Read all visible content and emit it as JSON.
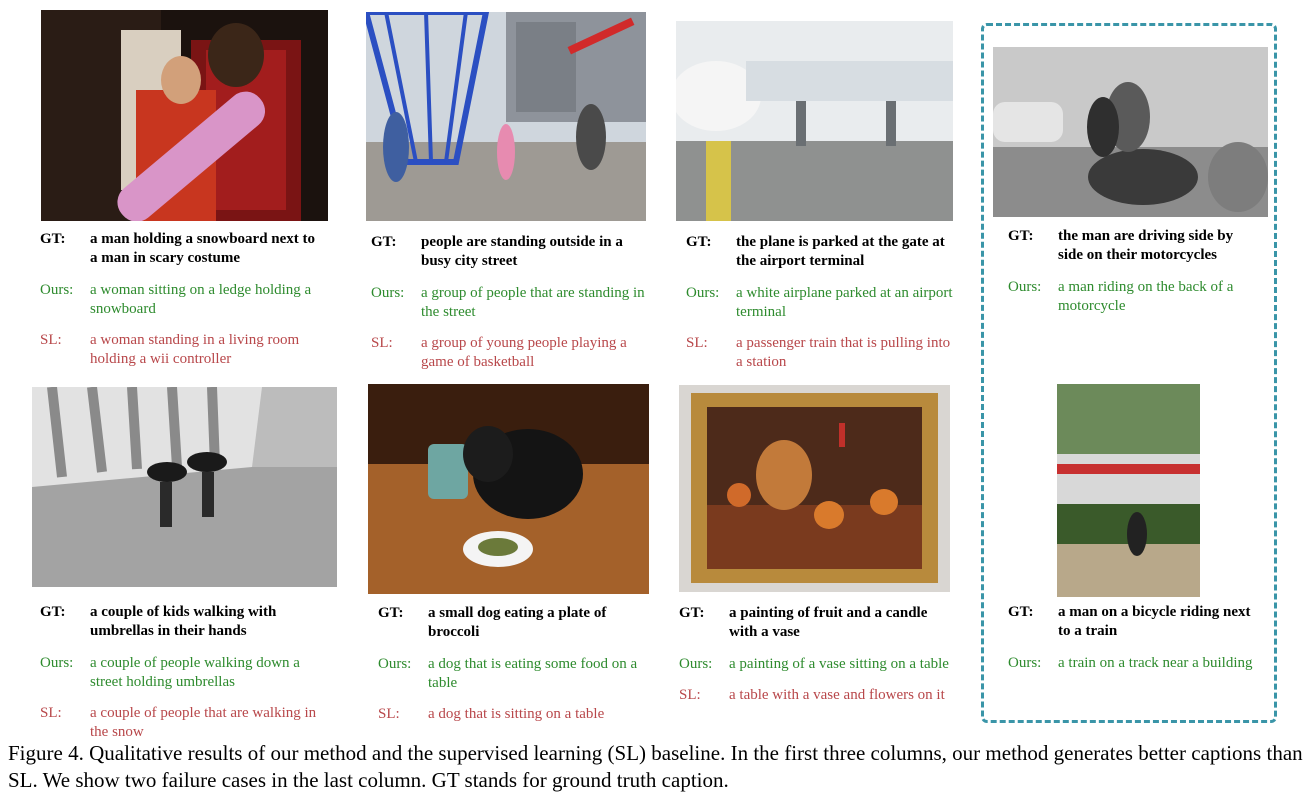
{
  "figure": {
    "caption": "Figure 4.  Qualitative results of our method and the supervised learning (SL) baseline. In the first three columns, our method generates better captions than SL. We show two failure cases in the last column. GT stands for ground truth caption."
  },
  "labels": {
    "gt": "GT:",
    "ours": "Ours:",
    "sl": "SL:"
  },
  "examples": [
    {
      "gt": "a man holding a snowboard next to a man in scary costume",
      "ours": "a woman sitting on a ledge holding a snowboard",
      "sl": "a woman standing in a living room holding a wii controller"
    },
    {
      "gt": "people are standing outside in a busy city street",
      "ours": "a group of people that are standing in the street",
      "sl": "a group of young people playing a game of basketball"
    },
    {
      "gt": "the plane is parked at the gate at the airport terminal",
      "ours": "a white airplane parked at an airport terminal",
      "sl": "a passenger train that is pulling into a station"
    },
    {
      "gt": "the man are driving side by side on their motorcycles",
      "ours": "a man riding on the back of a motorcycle"
    },
    {
      "gt": "a couple of kids walking with umbrellas in their hands",
      "ours": "a couple of people walking down a street holding umbrellas",
      "sl": "a couple of people that are walking in the snow"
    },
    {
      "gt": "a small dog eating a plate of broccoli",
      "ours": "a dog that is eating some food on a table",
      "sl": "a dog that is sitting on a table"
    },
    {
      "gt": "a painting of fruit and a candle with a vase",
      "ours": "a painting of a vase sitting on a table",
      "sl": "a table with a vase and flowers on it"
    },
    {
      "gt": "a man on a bicycle riding next to a train",
      "ours": "a train on a track near a building"
    }
  ],
  "colors": {
    "ours": "#2e8b2e",
    "sl": "#b8474a",
    "failure_box": "#3a95a8"
  }
}
